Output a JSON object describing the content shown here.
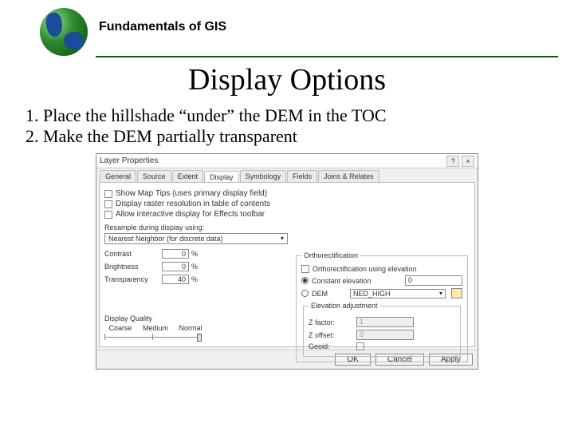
{
  "header": {
    "course": "Fundamentals of GIS"
  },
  "title": "Display Options",
  "steps": [
    "Place the hillshade “under” the DEM in the TOC",
    "Make the DEM partially transparent"
  ],
  "dialog": {
    "title": "Layer Properties",
    "help": "?",
    "close": "×",
    "tabs": [
      "General",
      "Source",
      "Extent",
      "Display",
      "Symbology",
      "Fields",
      "Joins & Relates"
    ],
    "active_tab": "Display",
    "opts": {
      "maptips": "Show Map Tips (uses primary display field)",
      "resolution": "Display raster resolution in table of contents",
      "effects": "Allow interactive display for Effects toolbar"
    },
    "resample_label": "Resample during display using:",
    "resample_value": "Nearest Neighbor (for discrete data)",
    "contrast_label": "Contrast",
    "contrast_value": "0",
    "brightness_label": "Brightness",
    "brightness_value": "0",
    "transparency_label": "Transparency",
    "transparency_value": "40",
    "pct": "%",
    "quality": {
      "label": "Display Quality",
      "coarse": "Coarse",
      "medium": "Medium",
      "normal": "Normal"
    },
    "ortho": {
      "title": "Orthorectification",
      "enable": "Orthorectification using elevation",
      "constant": "Constant elevation",
      "constant_val": "0",
      "dem": "DEM",
      "dem_value": "NED_HIGH",
      "pixeladj": "Elevation adjustment",
      "zfactor_label": "Z factor:",
      "zfactor_val": "1",
      "zoffset_label": "Z offset:",
      "zoffset_val": "0",
      "geoid_label": "Geoid:"
    },
    "buttons": {
      "ok": "OK",
      "cancel": "Cancel",
      "apply": "Apply"
    }
  }
}
